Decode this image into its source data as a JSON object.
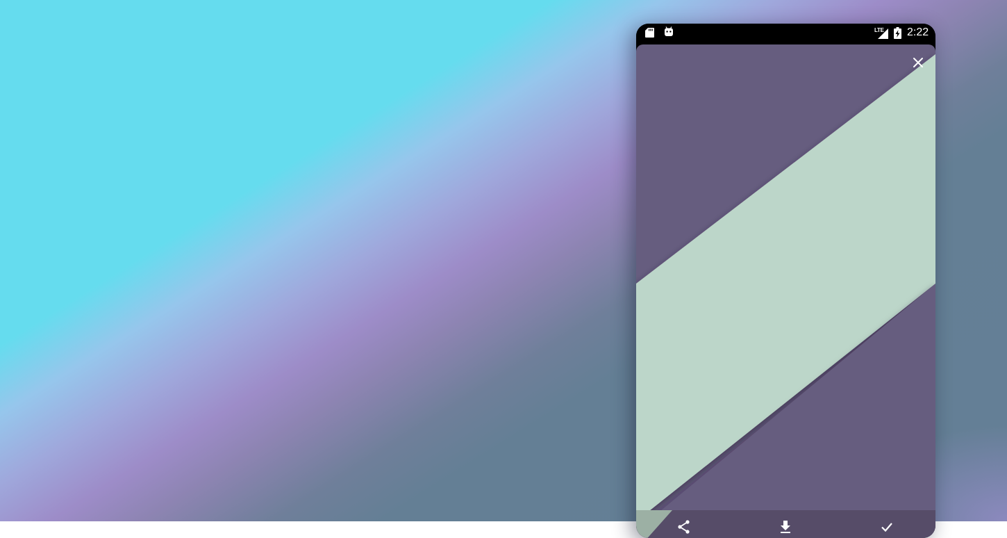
{
  "status_bar": {
    "time": "2:22",
    "network_label": "LTE",
    "icons": [
      "sd-card-icon",
      "android-icon",
      "signal-icon",
      "battery-charging-icon"
    ]
  },
  "wallpaper_preview": {
    "colors": {
      "purple": "#665d7f",
      "mint": "#bcd6c9",
      "bottom_bar": "#564c68"
    }
  },
  "actions": {
    "close_icon": "close-icon",
    "share_icon": "share-icon",
    "download_icon": "download-icon",
    "apply_icon": "check-icon"
  },
  "background_colors": [
    "#65dcee",
    "#9fa8dc",
    "#9d8cc8",
    "#647f95"
  ]
}
